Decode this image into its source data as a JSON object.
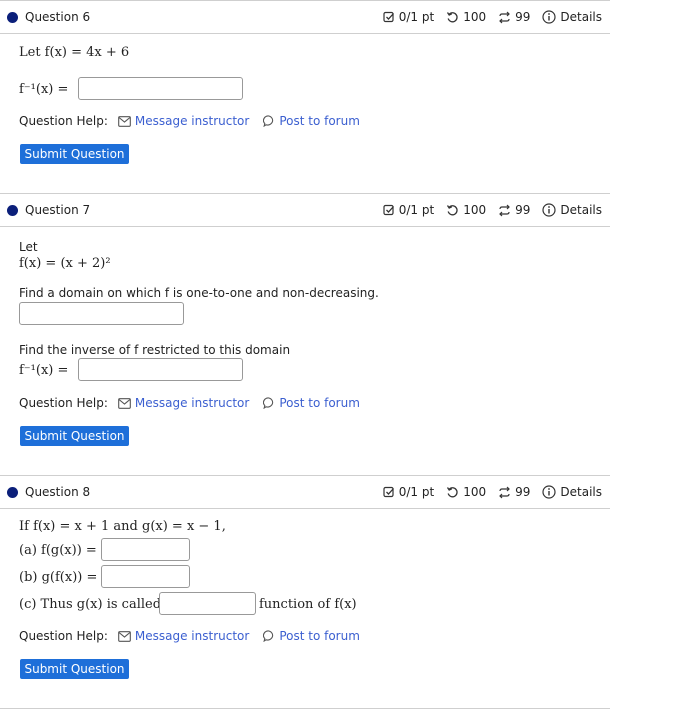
{
  "questions": [
    {
      "title": "Question 6",
      "score": "0/1 pt",
      "retries": "100",
      "attempts": "99",
      "details": "Details",
      "prompt": "Let f(x) = 4x + 6",
      "inverse_label": "f⁻¹(x) =",
      "help_label": "Question Help:",
      "message": "Message instructor",
      "forum": "Post to forum",
      "submit": "Submit Question"
    },
    {
      "title": "Question 7",
      "score": "0/1 pt",
      "retries": "100",
      "attempts": "99",
      "details": "Details",
      "let": "Let",
      "func": "f(x) = (x + 2)²",
      "domain_prompt": "Find a domain on which f is one-to-one and non-decreasing.",
      "inverse_prompt": "Find the inverse of f restricted to this domain",
      "inverse_label": "f⁻¹(x) =",
      "help_label": "Question Help:",
      "message": "Message instructor",
      "forum": "Post to forum",
      "submit": "Submit Question"
    },
    {
      "title": "Question 8",
      "score": "0/1 pt",
      "retries": "100",
      "attempts": "99",
      "details": "Details",
      "prompt": "If f(x) = x + 1 and g(x) = x − 1,",
      "part_a": "(a) f(g(x)) =",
      "part_b": "(b) g(f(x)) =",
      "part_c_pre": "(c) Thus g(x) is called an",
      "part_c_post": "function of f(x)",
      "help_label": "Question Help:",
      "message": "Message instructor",
      "forum": "Post to forum",
      "submit": "Submit Question"
    }
  ]
}
